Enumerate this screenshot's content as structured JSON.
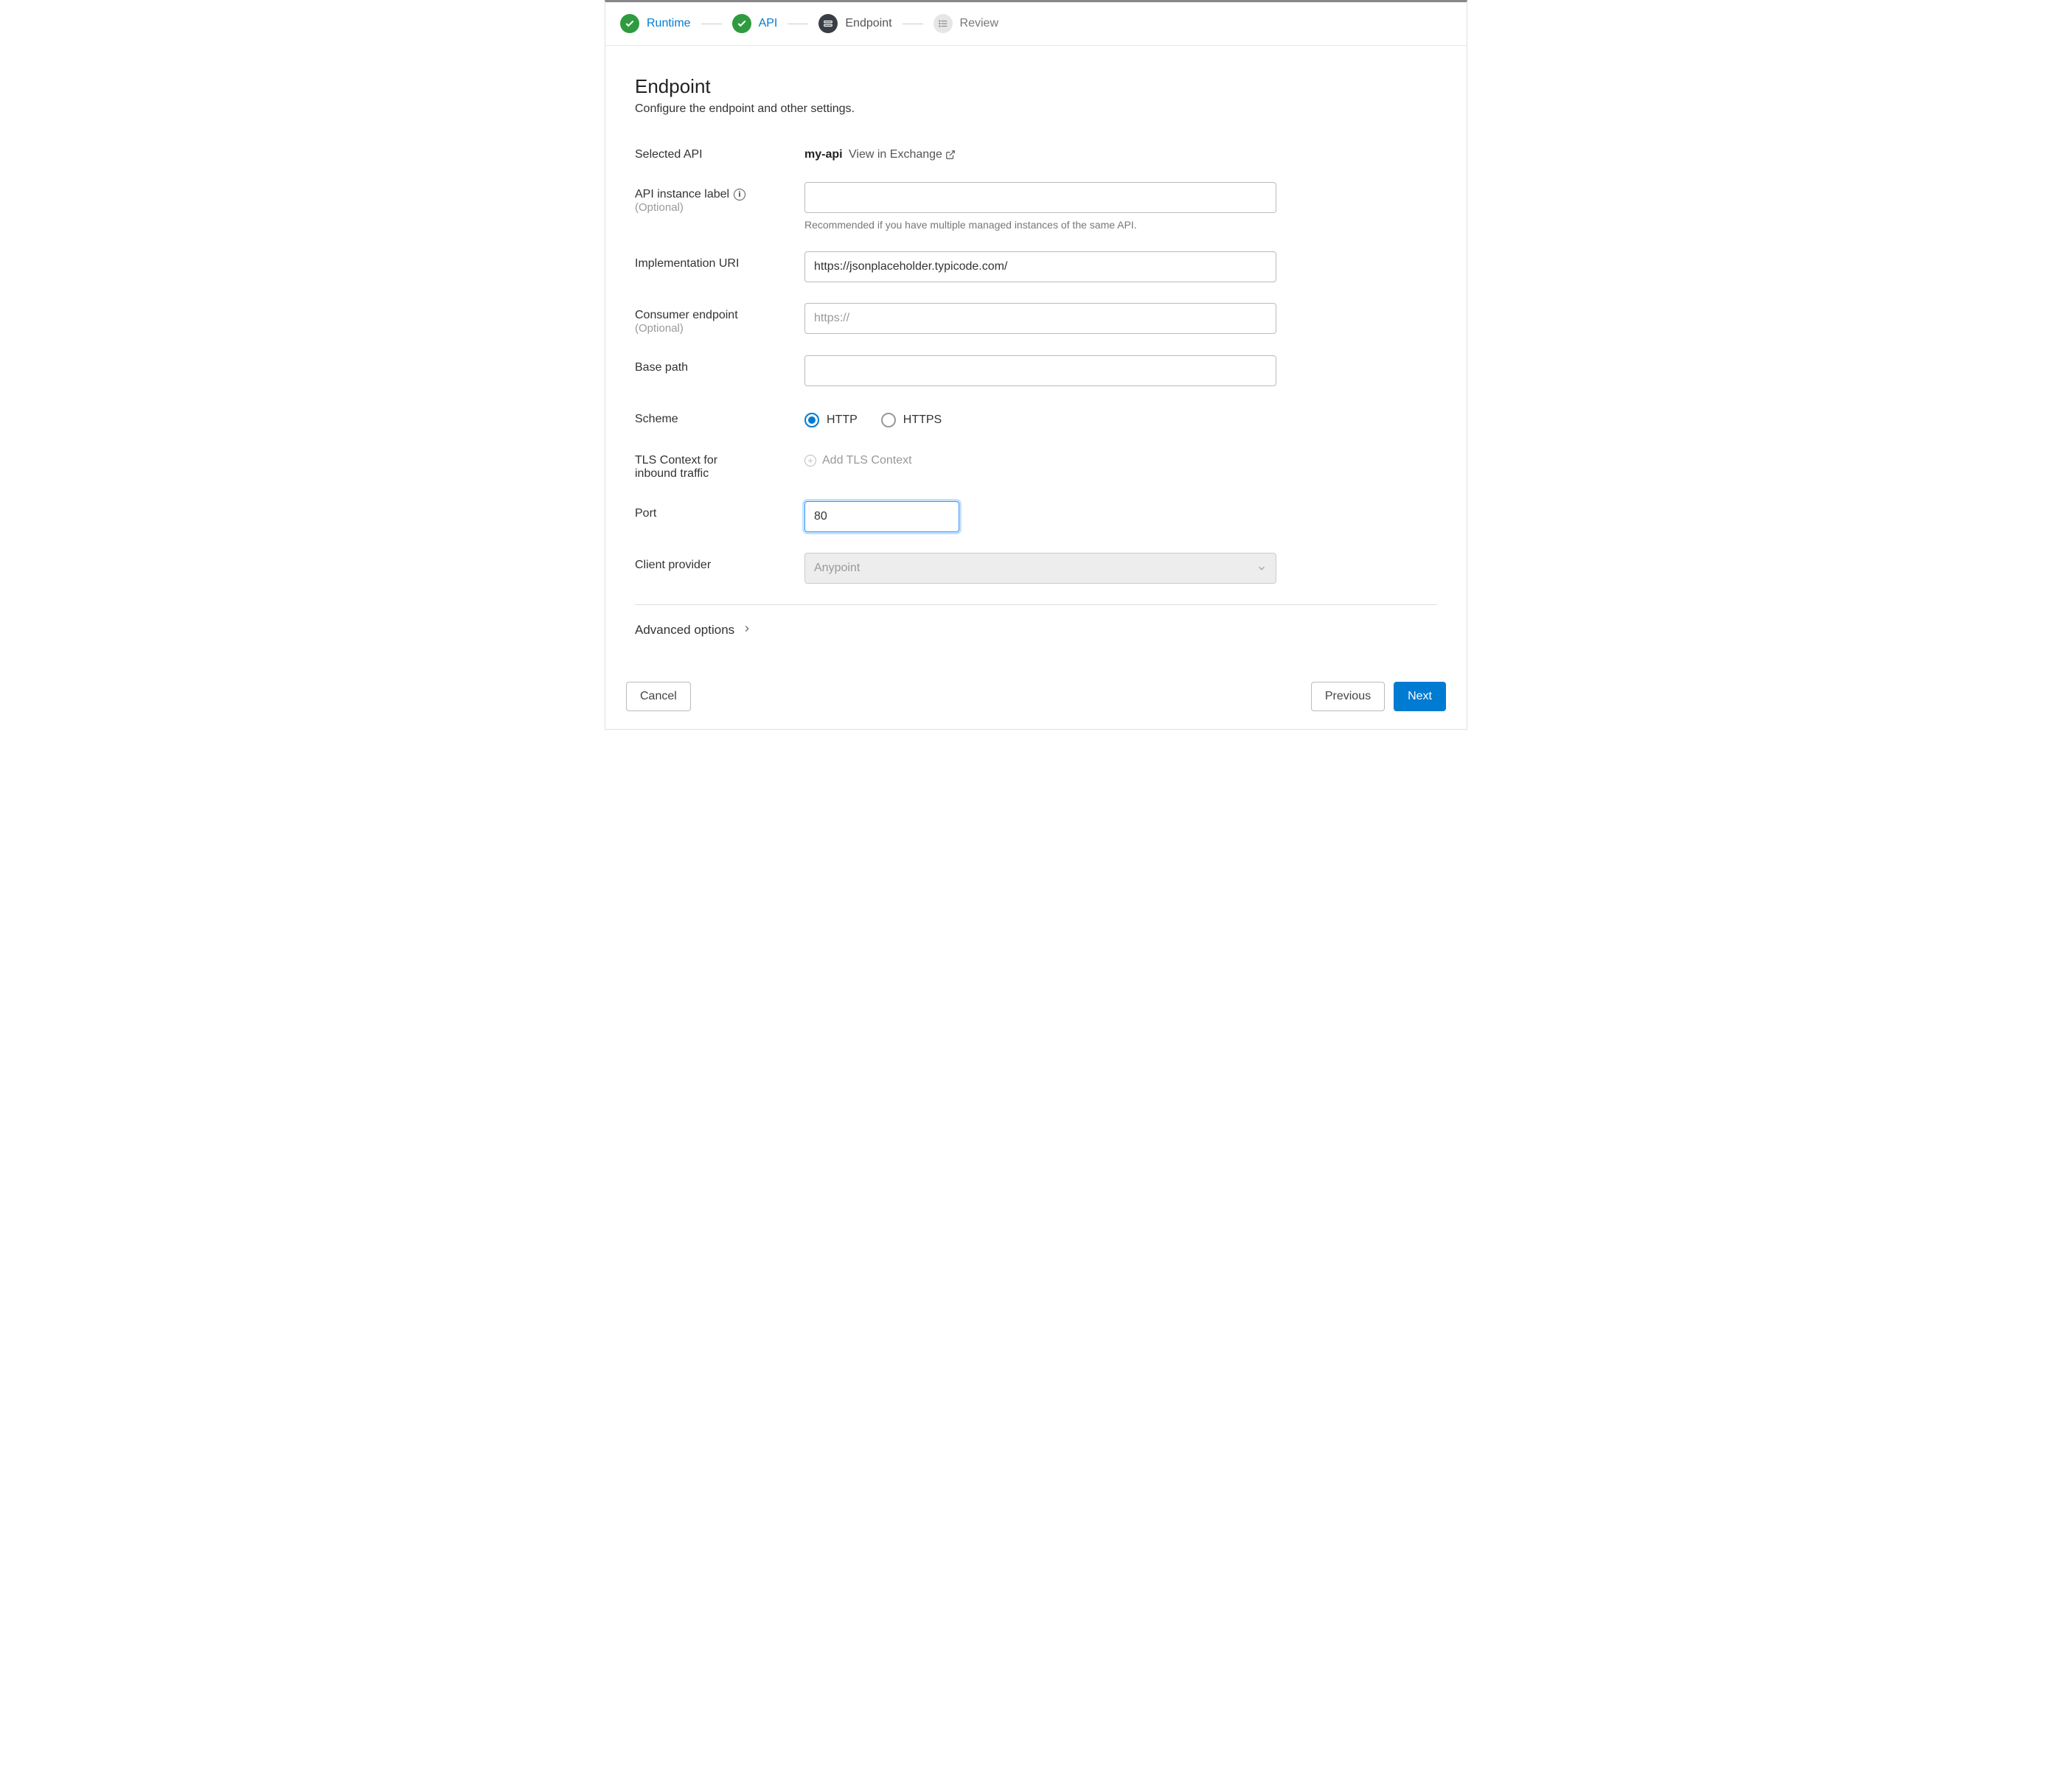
{
  "stepper": {
    "steps": [
      {
        "label": "Runtime",
        "state": "complete"
      },
      {
        "label": "API",
        "state": "complete"
      },
      {
        "label": "Endpoint",
        "state": "active"
      },
      {
        "label": "Review",
        "state": "upcoming"
      }
    ]
  },
  "header": {
    "title": "Endpoint",
    "subtitle": "Configure the endpoint and other settings."
  },
  "selected_api": {
    "label": "Selected API",
    "value": "my-api",
    "view_link": "View in Exchange"
  },
  "instance_label": {
    "label": "API instance label",
    "optional": "(Optional)",
    "value": "",
    "helper": "Recommended if you have multiple managed instances of the same API."
  },
  "impl_uri": {
    "label": "Implementation URI",
    "value": "https://jsonplaceholder.typicode.com/"
  },
  "consumer_endpoint": {
    "label": "Consumer endpoint",
    "optional": "(Optional)",
    "placeholder": "https://",
    "value": ""
  },
  "base_path": {
    "label": "Base path",
    "value": ""
  },
  "scheme": {
    "label": "Scheme",
    "options": [
      "HTTP",
      "HTTPS"
    ],
    "selected": "HTTP"
  },
  "tls_context": {
    "label_line1": "TLS Context for",
    "label_line2": "inbound traffic",
    "add_label": "Add TLS Context"
  },
  "port": {
    "label": "Port",
    "value": "80"
  },
  "client_provider": {
    "label": "Client provider",
    "value": "Anypoint"
  },
  "advanced": {
    "label": "Advanced options"
  },
  "footer": {
    "cancel": "Cancel",
    "previous": "Previous",
    "next": "Next"
  }
}
